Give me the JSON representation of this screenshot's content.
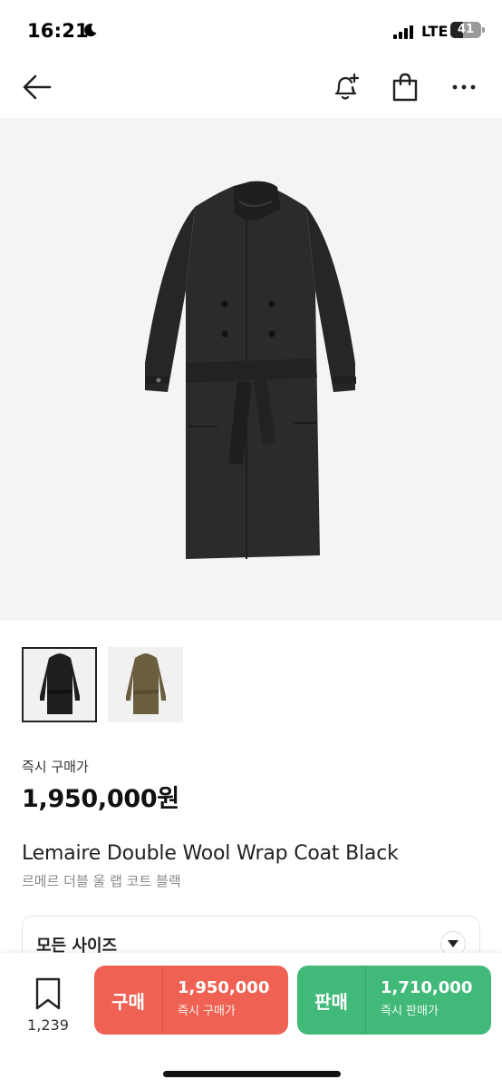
{
  "status": {
    "time": "16:21",
    "network": "LTE",
    "battery": "41",
    "battery_level": 0.41
  },
  "nav": {
    "back_icon": "arrow-left-icon",
    "alert_icon": "bell-plus-icon",
    "cart_icon": "shopping-bag-icon",
    "more_icon": "more-dots-icon"
  },
  "product": {
    "thumbnails": [
      {
        "name": "black-coat",
        "color": "#1e1e1e"
      },
      {
        "name": "olive-coat",
        "color": "#6b5e3e"
      }
    ],
    "instant_buy_label": "즉시 구매가",
    "instant_buy_price": "1,950,000원",
    "title_en": "Lemaire Double Wool Wrap Coat Black",
    "title_ko": "르메르 더블 울 랩 코트 블랙",
    "size_label": "모든 사이즈"
  },
  "bottom_bar": {
    "wish_count": "1,239",
    "buy": {
      "label": "구매",
      "price": "1,950,000",
      "sub": "즉시 구매가",
      "color": "#ef6253"
    },
    "sell": {
      "label": "판매",
      "price": "1,710,000",
      "sub": "즉시 판매가",
      "color": "#41b979"
    }
  }
}
